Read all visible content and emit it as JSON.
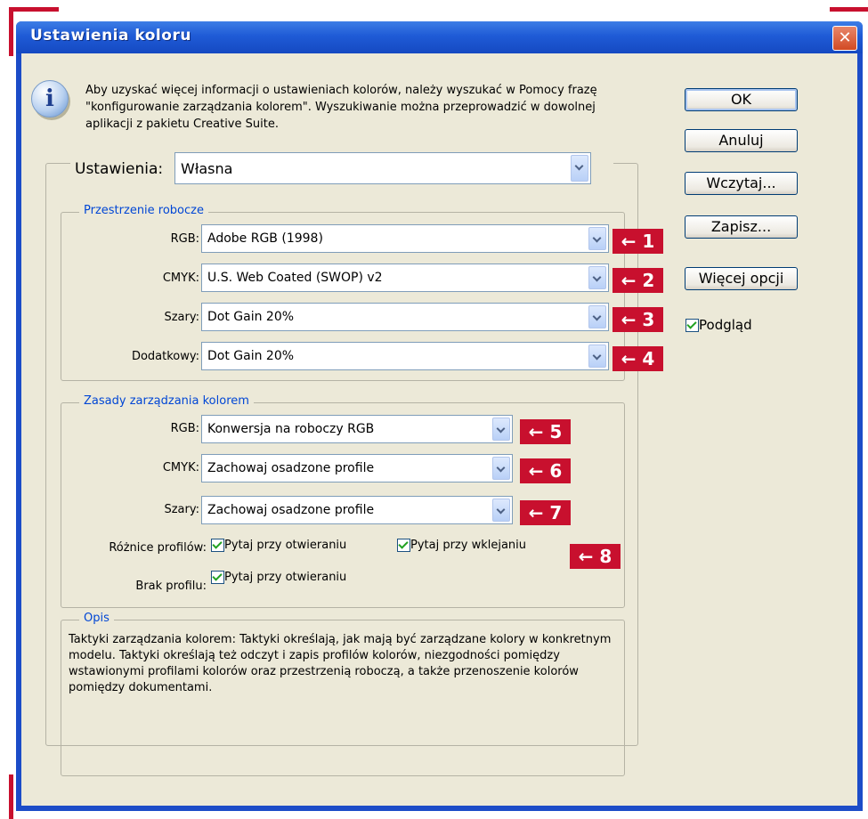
{
  "window": {
    "title": "Ustawienia koloru",
    "close_glyph": "✕"
  },
  "info": {
    "icon": "info-icon",
    "icon_glyph": "i",
    "text": "Aby uzyskać więcej informacji o ustawieniach kolorów, należy wyszukać w Pomocy frazę \"konfigurowanie zarządzania kolorem\". Wyszukiwanie można przeprowadzić w dowolnej aplikacji z pakietu Creative Suite."
  },
  "buttons": {
    "ok": "OK",
    "cancel": "Anuluj",
    "load": "Wczytaj...",
    "save": "Zapisz...",
    "more": "Więcej opcji"
  },
  "preview": {
    "label": "Podgląd",
    "checked": true
  },
  "settings": {
    "label": "Ustawienia:",
    "value": "Własna"
  },
  "workspaces": {
    "legend": "Przestrzenie robocze",
    "rows": [
      {
        "label": "RGB:",
        "value": "Adobe RGB (1998)",
        "marker": "1"
      },
      {
        "label": "CMYK:",
        "value": "U.S. Web Coated (SWOP) v2",
        "marker": "2"
      },
      {
        "label": "Szary:",
        "value": "Dot Gain 20%",
        "marker": "3"
      },
      {
        "label": "Dodatkowy:",
        "value": "Dot Gain 20%",
        "marker": "4"
      }
    ]
  },
  "policies": {
    "legend": "Zasady zarządzania kolorem",
    "rows": [
      {
        "label": "RGB:",
        "value": "Konwersja na roboczy RGB",
        "marker": "5"
      },
      {
        "label": "CMYK:",
        "value": "Zachowaj osadzone profile",
        "marker": "6"
      },
      {
        "label": "Szary:",
        "value": "Zachowaj osadzone profile",
        "marker": "7"
      }
    ],
    "mismatch": {
      "label": "Różnice profilów:",
      "open": "Pytaj przy otwieraniu",
      "paste": "Pytaj przy wklejaniu",
      "marker": "8"
    },
    "missing": {
      "label": "Brak profilu:",
      "open": "Pytaj przy otwieraniu"
    }
  },
  "description": {
    "legend": "Opis",
    "text": "Taktyki zarządzania kolorem: Taktyki określają, jak mają być zarządzane kolory w konkretnym modelu. Taktyki określają też odczyt i zapis profilów kolorów, niezgodności pomiędzy wstawionymi profilami kolorów oraz przestrzenią roboczą, a także przenoszenie kolorów pomiędzy dokumentami."
  },
  "marker_arrow": "←",
  "colors": {
    "accent_red": "#c8102e",
    "titlebar_blue": "#1f5bd6",
    "dialog_bg": "#ece9d8",
    "legend_blue": "#0046d5"
  }
}
